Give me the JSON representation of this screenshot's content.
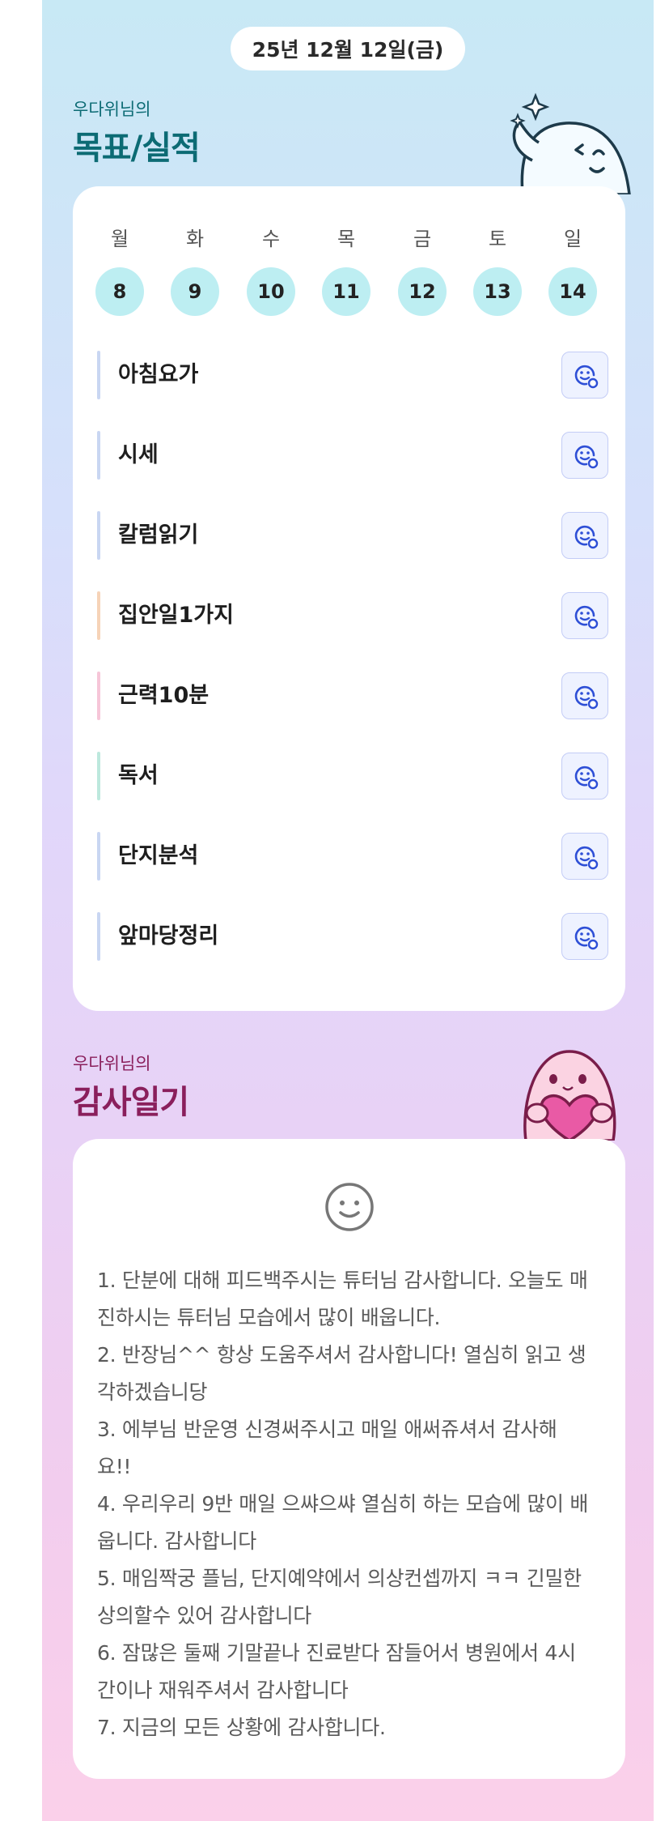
{
  "date": "25년 12월 12일(금)",
  "goals_section": {
    "subtitle": "우다위님의",
    "title": "목표/실적",
    "days": [
      {
        "name": "월",
        "num": "8"
      },
      {
        "name": "화",
        "num": "9"
      },
      {
        "name": "수",
        "num": "10"
      },
      {
        "name": "목",
        "num": "11"
      },
      {
        "name": "금",
        "num": "12"
      },
      {
        "name": "토",
        "num": "13"
      },
      {
        "name": "일",
        "num": "14"
      }
    ],
    "goals": [
      {
        "label": "아침요가",
        "color": "#c9d6f2"
      },
      {
        "label": "시세",
        "color": "#c9d6f2"
      },
      {
        "label": "칼럼읽기",
        "color": "#c9d6f2"
      },
      {
        "label": "집안일1가지",
        "color": "#f6d3b8"
      },
      {
        "label": "근력10분",
        "color": "#f6c6d8"
      },
      {
        "label": "독서",
        "color": "#bde8dd"
      },
      {
        "label": "단지분석",
        "color": "#c9d6f2"
      },
      {
        "label": "앞마당정리",
        "color": "#c9d6f2"
      }
    ],
    "title_color": "#0c6b74",
    "accent_color": "#2e4fd6"
  },
  "diary_section": {
    "subtitle": "우다위님의",
    "title": "감사일기",
    "title_color": "#8a1f5c",
    "text": "1. 단분에 대해 피드백주시는 튜터님 감사합니다. 오늘도 매진하시는 튜터님 모습에서 많이 배웁니다.\n2. 반장님^^ 항상 도움주셔서 감사합니다! 열심히 읽고 생각하겠습니당\n3. 에부님 반운영 신경써주시고 매일 애써쥬셔서 감사해요!!\n4. 우리우리 9반 매일 으쌰으쌰 열심히 하는 모습에 많이 배웁니다. 감사합니다\n5. 매임짝궁 플님, 단지예약에서 의상컨셉까지 ㅋㅋ 긴밀한 상의할수 있어 감사합니다\n6. 잠많은 둘째 기말끝나 진료받다 잠들어서 병원에서 4시간이나 재워주셔서 감사합니다\n7. 지금의 모든 상황에 감사합니다."
  }
}
